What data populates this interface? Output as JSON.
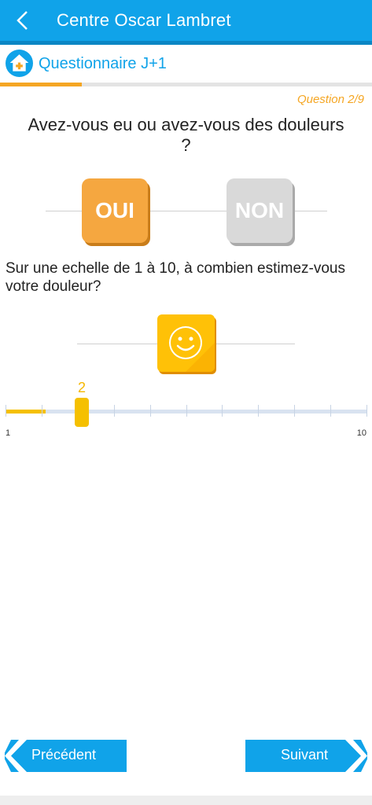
{
  "header": {
    "title": "Centre Oscar Lambret"
  },
  "subheader": {
    "title": "Questionnaire J+1",
    "progress_fraction": 0.22
  },
  "question_counter": "Question 2/9",
  "question1": {
    "text": "Avez-vous eu ou avez-vous des douleurs ?",
    "yes_label": "OUI",
    "no_label": "NON",
    "selected": "OUI"
  },
  "question2": {
    "text": "Sur une echelle de 1 à 10, à combien estimez-vous votre douleur?",
    "icon": "smiley-face-icon"
  },
  "slider": {
    "value": "2",
    "min": "1",
    "max": "10"
  },
  "nav": {
    "prev_label": "Précédent",
    "next_label": "Suivant"
  },
  "colors": {
    "primary": "#10a3e9",
    "accent": "#f5a623",
    "slider": "#f5c000"
  }
}
